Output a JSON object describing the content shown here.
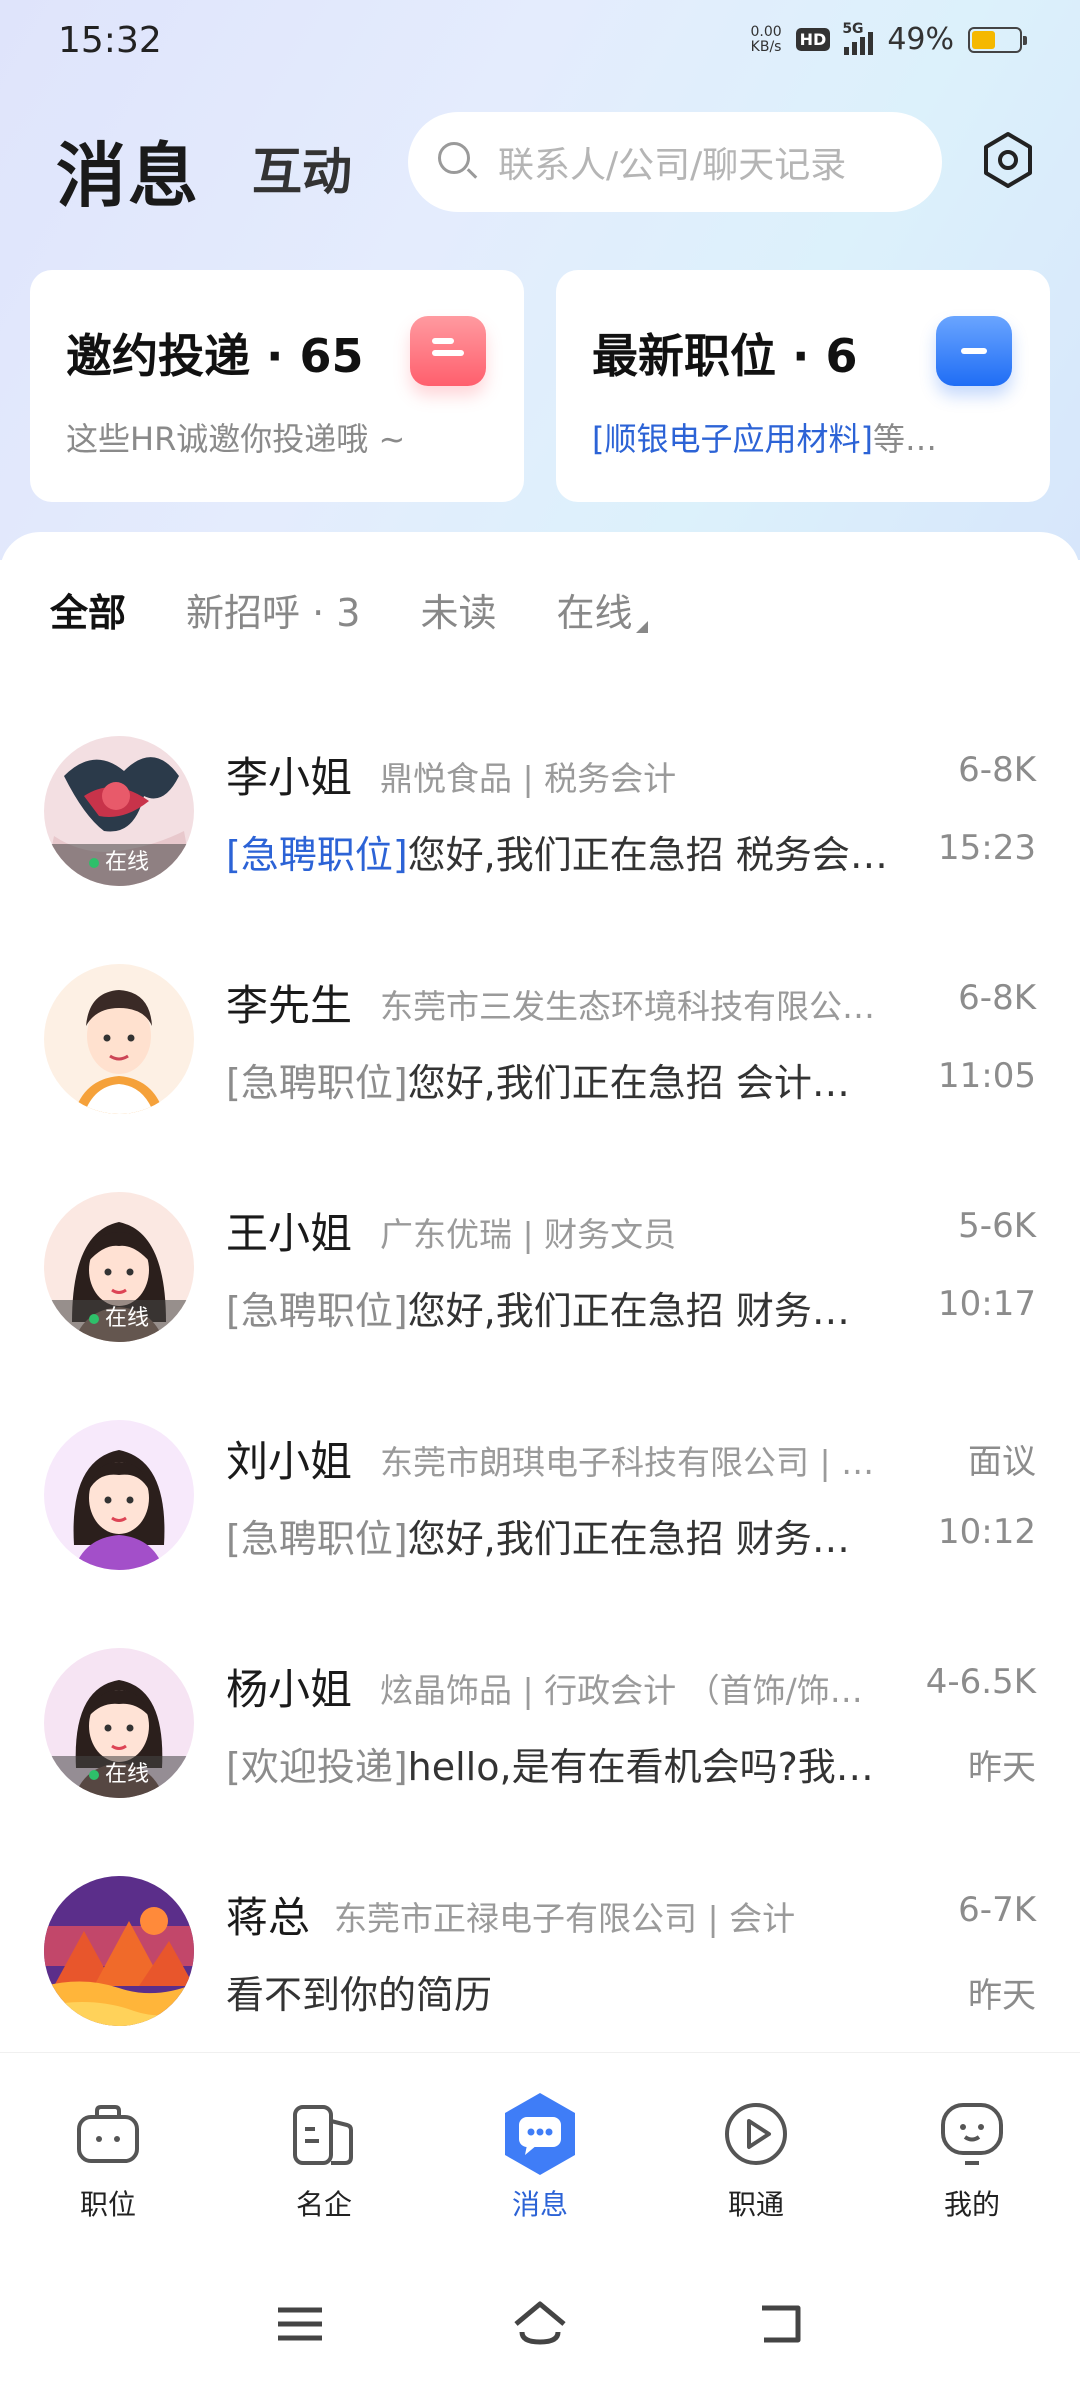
{
  "status_bar": {
    "time": "15:32",
    "net_speed_value": "0.00",
    "net_speed_unit": "KB/s",
    "hd": "HD",
    "network": "5G",
    "battery_percent": "49%",
    "battery_level": 0.49
  },
  "header": {
    "title": "消息",
    "subtitle": "互动",
    "search_placeholder": "联系人/公司/聊天记录"
  },
  "cards": [
    {
      "title": "邀约投递 · 65",
      "subtitle": "这些HR诚邀你投递哦 ~",
      "highlight": "",
      "icon": "invite-icon",
      "color": "#ff6b76"
    },
    {
      "title": "最新职位 · 6",
      "subtitle": "等…",
      "highlight": "[顺银电子应用材料]",
      "icon": "job-icon",
      "color": "#2f78f6"
    }
  ],
  "filters": [
    {
      "label": "全部",
      "active": true
    },
    {
      "label": "新招呼 · 3",
      "active": false
    },
    {
      "label": "未读",
      "active": false
    },
    {
      "label": "在线",
      "active": false
    }
  ],
  "online_label": "在线",
  "chats": [
    {
      "name": "李小姐",
      "company": "鼎悦食品 | 税务会计",
      "salary": "6-8K",
      "tag": "[急聘职位]",
      "message": "您好,我们正在急招 税务会计…",
      "time": "15:23",
      "online": true,
      "tag_blue": true
    },
    {
      "name": "李先生",
      "company": "东莞市三发生态环境科技有限公…",
      "salary": "6-8K",
      "tag": "[急聘职位]",
      "message": "您好,我们正在急招 会计…",
      "time": "11:05",
      "online": false,
      "tag_blue": false
    },
    {
      "name": "王小姐",
      "company": "广东优瑞 | 财务文员",
      "salary": "5-6K",
      "tag": "[急聘职位]",
      "message": "您好,我们正在急招 财务…",
      "time": "10:17",
      "online": true,
      "tag_blue": false
    },
    {
      "name": "刘小姐",
      "company": "东莞市朗琪电子科技有限公司 | …",
      "salary": "面议",
      "tag": "[急聘职位]",
      "message": "您好,我们正在急招 财务…",
      "time": "10:12",
      "online": false,
      "tag_blue": false
    },
    {
      "name": "杨小姐",
      "company": "炫晶饰品 | 行政会计 （首饰/饰…",
      "salary": "4-6.5K",
      "tag": "[欢迎投递]",
      "message": "hello,是有在看机会吗?我…",
      "time": "昨天",
      "online": true,
      "tag_blue": false
    },
    {
      "name": "蒋总",
      "company": "东莞市正禄电子有限公司 | 会计",
      "salary": "6-7K",
      "tag": "",
      "message": "看不到你的简历",
      "time": "昨天",
      "online": false,
      "tag_blue": false
    }
  ],
  "bottom_nav": [
    {
      "label": "职位",
      "icon": "briefcase-icon",
      "active": false
    },
    {
      "label": "名企",
      "icon": "company-icon",
      "active": false
    },
    {
      "label": "消息",
      "icon": "message-icon",
      "active": true
    },
    {
      "label": "职通",
      "icon": "play-icon",
      "active": false
    },
    {
      "label": "我的",
      "icon": "profile-icon",
      "active": false
    }
  ],
  "colors": {
    "accent": "#2c63d6",
    "online": "#2ec06a"
  }
}
